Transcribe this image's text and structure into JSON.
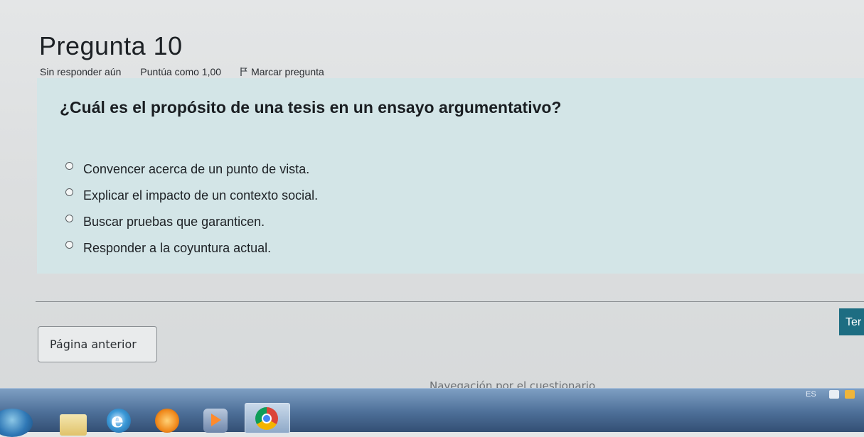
{
  "question": {
    "title": "Pregunta 10",
    "status": "Sin responder aún",
    "grade": "Puntúa como 1,00",
    "flag_label": "Marcar pregunta",
    "text": "¿Cuál es el propósito de una tesis en un ensayo argumentativo?",
    "answers": [
      "Convencer acerca de un punto de vista.",
      "Explicar el impacto de un contexto social.",
      "Buscar pruebas que garanticen.",
      "Responder a la coyuntura actual."
    ]
  },
  "navigation": {
    "prev_label": "Página anterior",
    "next_label": "Ter",
    "quiz_nav_label": "Navegación por el cuestionario"
  },
  "taskbar": {
    "language": "ES"
  },
  "colors": {
    "question_box": "#d3e5e7",
    "next_button": "#1d6d82",
    "taskbar": "#4d6f98"
  }
}
